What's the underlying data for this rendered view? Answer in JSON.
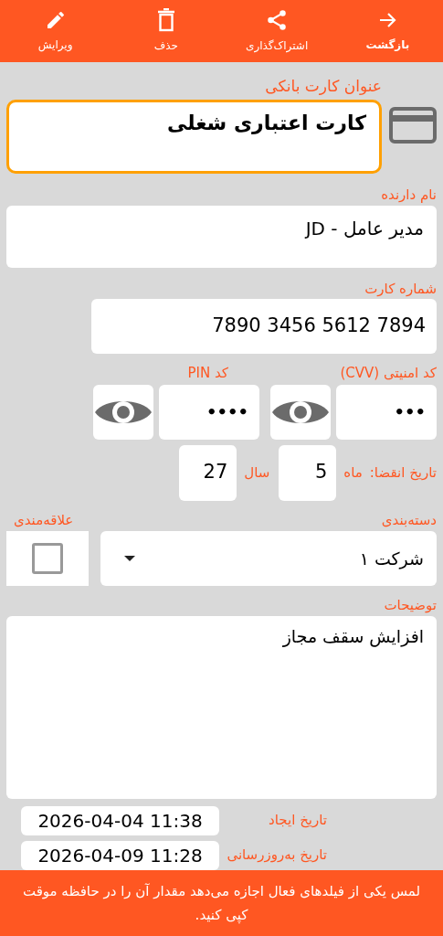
{
  "toolbar": [
    {
      "kind": "back",
      "label": "بازگشت"
    },
    {
      "kind": "share",
      "label": "اشتراک‌گذاری"
    },
    {
      "kind": "delete",
      "label": "حذف"
    },
    {
      "kind": "edit",
      "label": "ویرایش"
    }
  ],
  "title_field": {
    "label": "عنوان کارت بانکی",
    "value": "کارت اعتباری شغلی",
    "focused": true
  },
  "holder_field": {
    "label": "نام دارنده",
    "value": "مدیر عامل - JD"
  },
  "number_field": {
    "label": "شماره کارت",
    "value": "7890 3456 5612 7894"
  },
  "cvv_field": {
    "label": "کد امنیتی (CVV)",
    "value": "•••"
  },
  "pin_field": {
    "label": "کد PIN",
    "value": "••••"
  },
  "expiry": {
    "label": "تاریخ انقضا:",
    "month_label": "ماه",
    "month": "5",
    "year_label": "سال",
    "year": "27"
  },
  "category": {
    "label": "دسته‌بندی",
    "value": "شرکت ۱"
  },
  "favorite": {
    "label": "علاقه‌مندی",
    "checked": false
  },
  "notes": {
    "label": "توضیحات",
    "value": "افزایش سقف مجاز"
  },
  "created": {
    "label": "تاریخ ایجاد",
    "value": "2026-04-04 11:38"
  },
  "updated": {
    "label": "تاریخ به‌روزرسانی",
    "value": "2026-04-09 11:28"
  },
  "hint": "لمس یکی از فیلدهای فعال اجازه می‌دهد مقدار آن را در حافظه موقت کپی کنید."
}
